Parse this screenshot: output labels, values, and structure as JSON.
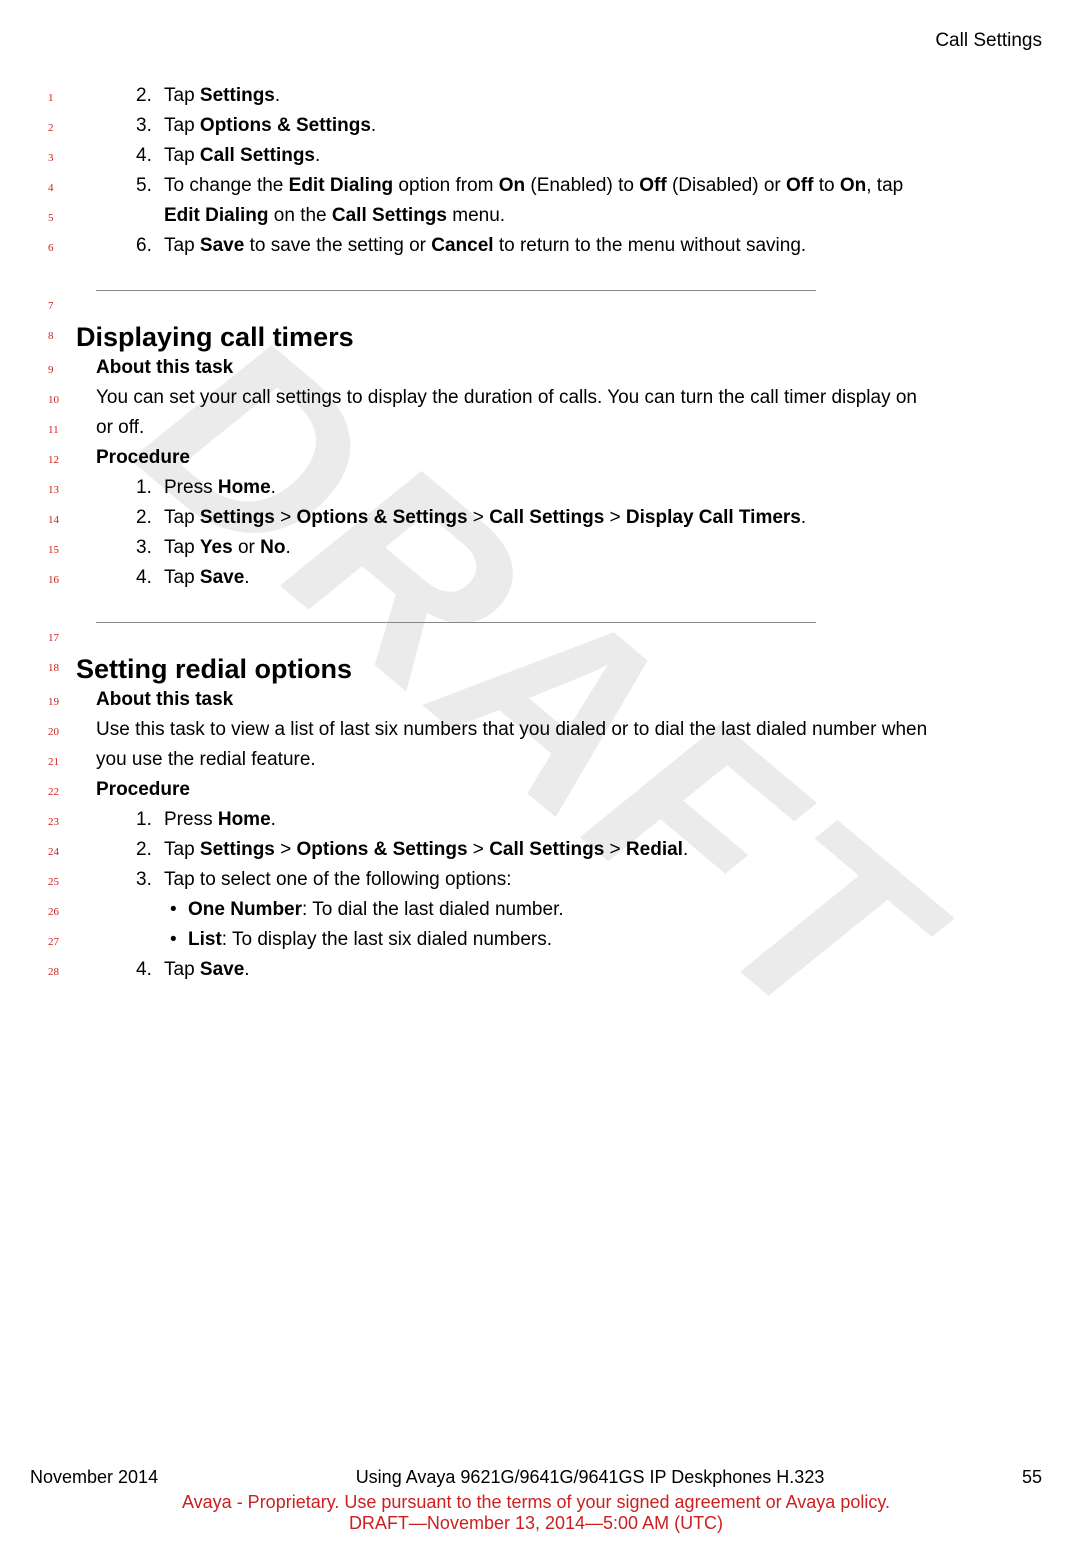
{
  "header": {
    "section": "Call Settings"
  },
  "watermark": "DRAFT",
  "lines": [
    {
      "n": "1",
      "type": "step",
      "num": "2.",
      "parts": [
        [
          "",
          "Tap "
        ],
        [
          "b",
          "Settings"
        ],
        [
          "",
          "."
        ]
      ]
    },
    {
      "n": "2",
      "type": "step",
      "num": "3.",
      "parts": [
        [
          "",
          "Tap "
        ],
        [
          "b",
          "Options & Settings"
        ],
        [
          "",
          "."
        ]
      ]
    },
    {
      "n": "3",
      "type": "step",
      "num": "4.",
      "parts": [
        [
          "",
          "Tap "
        ],
        [
          "b",
          "Call Settings"
        ],
        [
          "",
          "."
        ]
      ]
    },
    {
      "n": "4",
      "type": "step",
      "num": "5.",
      "parts": [
        [
          "",
          "To change the "
        ],
        [
          "b",
          "Edit Dialing"
        ],
        [
          "",
          " option from "
        ],
        [
          "b",
          "On"
        ],
        [
          "",
          " (Enabled) to "
        ],
        [
          "b",
          "Off"
        ],
        [
          "",
          " (Disabled) or "
        ],
        [
          "b",
          "Off"
        ],
        [
          "",
          " to "
        ],
        [
          "b",
          "On"
        ],
        [
          "",
          ", tap"
        ]
      ]
    },
    {
      "n": "5",
      "type": "stepcont",
      "parts": [
        [
          "b",
          "Edit Dialing"
        ],
        [
          "",
          " on the "
        ],
        [
          "b",
          "Call Settings"
        ],
        [
          "",
          " menu."
        ]
      ]
    },
    {
      "n": "6",
      "type": "step",
      "num": "6.",
      "parts": [
        [
          "",
          "Tap "
        ],
        [
          "b",
          "Save"
        ],
        [
          "",
          " to save the setting or "
        ],
        [
          "b",
          "Cancel"
        ],
        [
          "",
          " to return to the menu without saving."
        ]
      ]
    },
    {
      "type": "gap-lg"
    },
    {
      "n": "7",
      "type": "hr"
    },
    {
      "n": "8",
      "type": "h2",
      "text": "Displaying call timers"
    },
    {
      "n": "9",
      "type": "sub",
      "text": "About this task"
    },
    {
      "n": "10",
      "type": "para",
      "parts": [
        [
          "",
          "You can set your call settings to display the duration of calls. You can turn the call timer display on"
        ]
      ]
    },
    {
      "n": "11",
      "type": "para",
      "parts": [
        [
          "",
          "or off."
        ]
      ]
    },
    {
      "n": "12",
      "type": "sub",
      "text": "Procedure"
    },
    {
      "n": "13",
      "type": "step",
      "num": "1.",
      "parts": [
        [
          "",
          "Press "
        ],
        [
          "b",
          "Home"
        ],
        [
          "",
          "."
        ]
      ]
    },
    {
      "n": "14",
      "type": "step",
      "num": "2.",
      "parts": [
        [
          "",
          "Tap "
        ],
        [
          "b",
          "Settings"
        ],
        [
          "",
          " > "
        ],
        [
          "b",
          "Options & Settings"
        ],
        [
          "",
          " > "
        ],
        [
          "b",
          "Call Settings"
        ],
        [
          "",
          " > "
        ],
        [
          "b",
          "Display Call Timers"
        ],
        [
          "",
          "."
        ]
      ]
    },
    {
      "n": "15",
      "type": "step",
      "num": "3.",
      "parts": [
        [
          "",
          "Tap "
        ],
        [
          "b",
          "Yes"
        ],
        [
          "",
          " or "
        ],
        [
          "b",
          "No"
        ],
        [
          "",
          "."
        ]
      ]
    },
    {
      "n": "16",
      "type": "step",
      "num": "4.",
      "parts": [
        [
          "",
          "Tap "
        ],
        [
          "b",
          "Save"
        ],
        [
          "",
          "."
        ]
      ]
    },
    {
      "type": "gap-lg"
    },
    {
      "n": "17",
      "type": "hr"
    },
    {
      "n": "18",
      "type": "h2",
      "text": "Setting redial options"
    },
    {
      "n": "19",
      "type": "sub",
      "text": "About this task"
    },
    {
      "n": "20",
      "type": "para",
      "parts": [
        [
          "",
          "Use this task to view a list of last six numbers that you dialed or to dial the last dialed number when"
        ]
      ]
    },
    {
      "n": "21",
      "type": "para",
      "parts": [
        [
          "",
          "you use the redial feature."
        ]
      ]
    },
    {
      "n": "22",
      "type": "sub",
      "text": "Procedure"
    },
    {
      "n": "23",
      "type": "step",
      "num": "1.",
      "parts": [
        [
          "",
          "Press "
        ],
        [
          "b",
          "Home"
        ],
        [
          "",
          "."
        ]
      ]
    },
    {
      "n": "24",
      "type": "step",
      "num": "2.",
      "parts": [
        [
          "",
          "Tap "
        ],
        [
          "b",
          "Settings"
        ],
        [
          "",
          " > "
        ],
        [
          "b",
          "Options & Settings"
        ],
        [
          "",
          " > "
        ],
        [
          "b",
          "Call Settings"
        ],
        [
          "",
          " > "
        ],
        [
          "b",
          "Redial"
        ],
        [
          "",
          "."
        ]
      ]
    },
    {
      "n": "25",
      "type": "step",
      "num": "3.",
      "parts": [
        [
          "",
          "Tap to select one of the following options:"
        ]
      ]
    },
    {
      "n": "26",
      "type": "bullet",
      "parts": [
        [
          "b",
          "One Number"
        ],
        [
          "",
          ": To dial the last dialed number."
        ]
      ]
    },
    {
      "n": "27",
      "type": "bullet",
      "parts": [
        [
          "b",
          "List"
        ],
        [
          "",
          ": To display the last six dialed numbers."
        ]
      ]
    },
    {
      "n": "28",
      "type": "step",
      "num": "4.",
      "parts": [
        [
          "",
          "Tap "
        ],
        [
          "b",
          "Save"
        ],
        [
          "",
          "."
        ]
      ]
    }
  ],
  "footer": {
    "date": "November 2014",
    "title": "Using Avaya 9621G/9641G/9641GS IP Deskphones H.323",
    "page": "55",
    "line2": "Avaya - Proprietary. Use pursuant to the terms of your signed agreement or Avaya policy.",
    "line3": "DRAFT—November 13, 2014—5:00 AM (UTC)"
  }
}
